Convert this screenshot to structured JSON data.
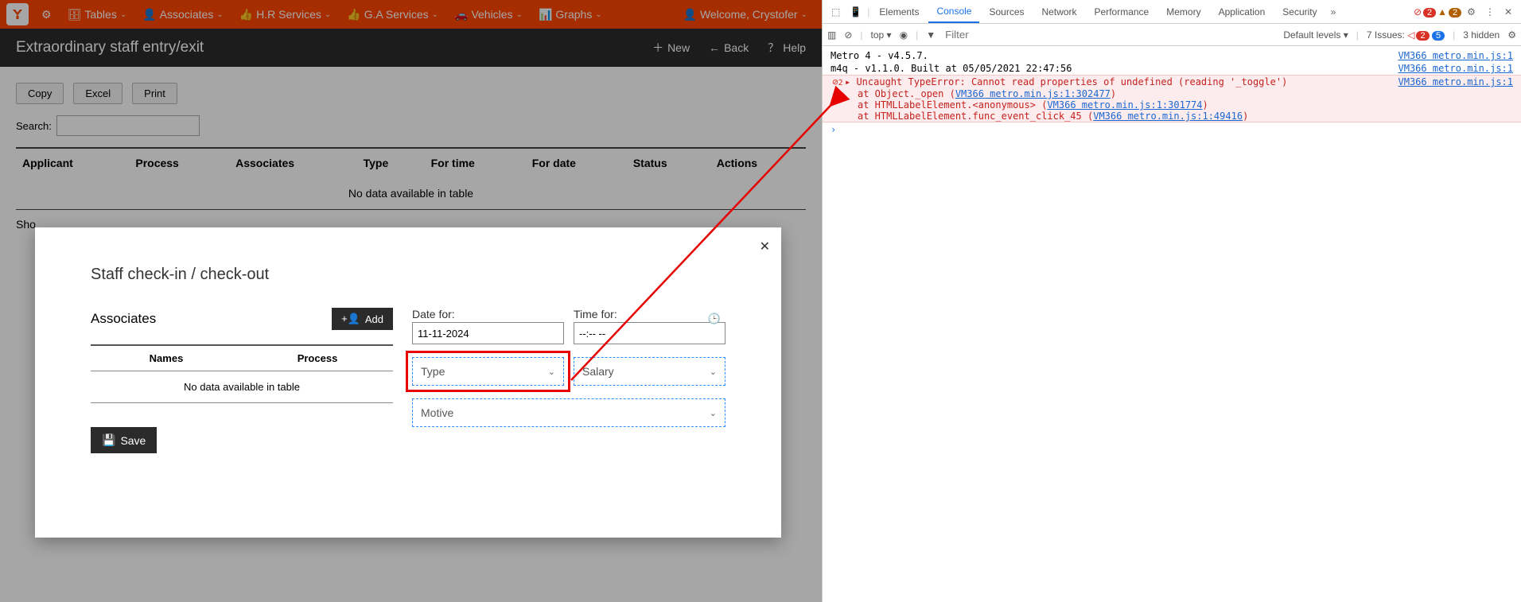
{
  "nav": {
    "tables": "Tables",
    "associates": "Associates",
    "hr": "H.R Services",
    "ga": "G.A Services",
    "vehicles": "Vehicles",
    "graphs": "Graphs",
    "welcome": "Welcome, Crystofer"
  },
  "page": {
    "title": "Extraordinary staff entry/exit",
    "new": "New",
    "back": "Back",
    "help": "Help"
  },
  "buttons": {
    "copy": "Copy",
    "excel": "Excel",
    "print": "Print"
  },
  "search": {
    "label": "Search:"
  },
  "table": {
    "cols": {
      "applicant": "Applicant",
      "process": "Process",
      "associates": "Associates",
      "type": "Type",
      "fortime": "For time",
      "fordate": "For date",
      "status": "Status",
      "actions": "Actions"
    },
    "nodata": "No data available in table"
  },
  "showing": "Sho",
  "modal": {
    "title": "Staff check-in / check-out",
    "assoc_title": "Associates",
    "add": "Add",
    "col_names": "Names",
    "col_process": "Process",
    "nodata": "No data available in table",
    "date_label": "Date for:",
    "date_value": "11-11-2024",
    "time_label": "Time for:",
    "time_value": "--:-- --",
    "dd_type": "Type",
    "dd_salary": "Salary",
    "dd_motive": "Motive",
    "save": "Save"
  },
  "devtools": {
    "tabs": {
      "elements": "Elements",
      "console": "Console",
      "sources": "Sources",
      "network": "Network",
      "performance": "Performance",
      "memory": "Memory",
      "application": "Application",
      "security": "Security"
    },
    "err_count": "2",
    "warn_count": "2",
    "toolbar": {
      "top": "top",
      "filter_ph": "Filter",
      "levels": "Default levels",
      "issues_label": "7 Issues:",
      "issues_err": "2",
      "issues_info": "5",
      "hidden": "3 hidden"
    },
    "log1": "Metro 4 - v4.5.7.",
    "log2": "m4q - v1.1.0. Built at 05/05/2021 22:47:56",
    "src": "VM366 metro.min.js:1",
    "err_main": "Uncaught TypeError: Cannot read properties of undefined (reading '_toggle')",
    "err_l1a": "    at Object._open (",
    "err_l1b": "VM366 metro.min.js:1:302477",
    "err_l1c": ")",
    "err_l2a": "    at HTMLLabelElement.<anonymous> (",
    "err_l2b": "VM366 metro.min.js:1:301774",
    "err_l2c": ")",
    "err_l3a": "    at HTMLLabelElement.func_event_click_45 (",
    "err_l3b": "VM366 metro.min.js:1:49416",
    "err_l3c": ")",
    "err_badge_count": "2"
  }
}
